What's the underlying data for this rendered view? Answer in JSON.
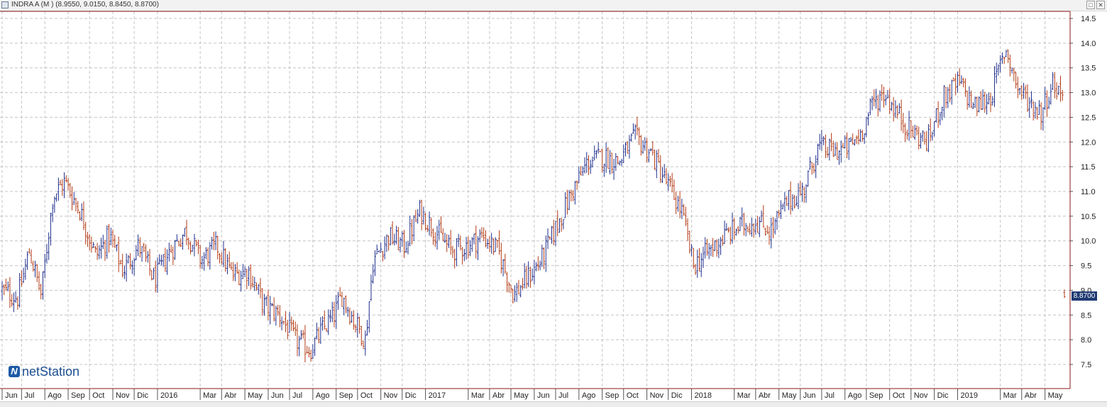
{
  "window": {
    "title": "INDRA A (M ) (8.9550, 9.0150, 8.8450, 8.8700)",
    "buttons": [
      "□",
      "✕"
    ]
  },
  "logo": {
    "mark": "N",
    "text": "netStation"
  },
  "price_tag": "8.8700",
  "colors": {
    "up_bar": "#1f2f8c",
    "down_bar": "#b23a14",
    "grid": "#c4c4c4",
    "frame": "#8b1a1a",
    "price_tag_bg": "#1f3a73"
  },
  "chart_data": {
    "type": "ohlc",
    "title": "INDRA A (M )",
    "last_ohlc": {
      "open": 8.955,
      "high": 9.015,
      "low": 8.845,
      "close": 8.87
    },
    "ylim": [
      7.0,
      14.7
    ],
    "y_ticks": [
      "14.5",
      "14.0",
      "13.5",
      "13.0",
      "12.5",
      "12.0",
      "11.5",
      "11.0",
      "10.5",
      "10.0",
      "9.5",
      "9.0",
      "8.5",
      "8.0",
      "7.5"
    ],
    "x_labels": [
      "Jun",
      "Jul",
      "Ago",
      "Sep",
      "Oct",
      "Nov",
      "Dic",
      "2016",
      "Mar",
      "Abr",
      "May",
      "Jun",
      "Jul",
      "Ago",
      "Sep",
      "Oct",
      "Nov",
      "Dic",
      "2017",
      "Mar",
      "Abr",
      "May",
      "Jun",
      "Jul",
      "Ago",
      "Sep",
      "Oct",
      "Nov",
      "Dic",
      "2018",
      "Mar",
      "Abr",
      "May",
      "Jun",
      "Jul",
      "Ago",
      "Sep",
      "Oct",
      "Nov",
      "Dic",
      "2019",
      "Mar",
      "Abr",
      "May"
    ],
    "x_label_index": [
      0,
      10,
      22,
      34,
      45,
      57,
      68,
      80,
      102,
      113,
      125,
      137,
      148,
      160,
      172,
      183,
      195,
      206,
      218,
      240,
      251,
      262,
      274,
      285,
      297,
      309,
      320,
      332,
      343,
      355,
      377,
      388,
      400,
      411,
      422,
      434,
      445,
      457,
      468,
      480,
      492,
      514,
      525,
      537
    ],
    "num_bars": 548,
    "close_path": [
      [
        0,
        9.0
      ],
      [
        8,
        8.85
      ],
      [
        14,
        9.8
      ],
      [
        20,
        8.9
      ],
      [
        26,
        10.9
      ],
      [
        32,
        11.2
      ],
      [
        40,
        10.6
      ],
      [
        48,
        9.7
      ],
      [
        55,
        10.1
      ],
      [
        62,
        9.4
      ],
      [
        70,
        9.9
      ],
      [
        78,
        9.2
      ],
      [
        86,
        9.8
      ],
      [
        94,
        10.2
      ],
      [
        102,
        9.6
      ],
      [
        110,
        9.9
      ],
      [
        118,
        9.3
      ],
      [
        126,
        9.4
      ],
      [
        134,
        8.7
      ],
      [
        142,
        8.5
      ],
      [
        150,
        8.0
      ],
      [
        158,
        7.8
      ],
      [
        164,
        8.2
      ],
      [
        170,
        8.5
      ],
      [
        174,
        8.9
      ],
      [
        180,
        8.4
      ],
      [
        186,
        8.0
      ],
      [
        190,
        9.6
      ],
      [
        198,
        10.1
      ],
      [
        206,
        9.9
      ],
      [
        214,
        10.6
      ],
      [
        222,
        10.2
      ],
      [
        230,
        9.8
      ],
      [
        238,
        9.9
      ],
      [
        246,
        10.1
      ],
      [
        254,
        9.8
      ],
      [
        262,
        8.9
      ],
      [
        268,
        9.2
      ],
      [
        276,
        9.6
      ],
      [
        284,
        10.3
      ],
      [
        292,
        11.0
      ],
      [
        300,
        11.6
      ],
      [
        308,
        11.7
      ],
      [
        316,
        11.6
      ],
      [
        324,
        12.1
      ],
      [
        332,
        11.8
      ],
      [
        340,
        11.2
      ],
      [
        348,
        10.6
      ],
      [
        354,
        9.5
      ],
      [
        362,
        9.8
      ],
      [
        370,
        10.1
      ],
      [
        378,
        10.3
      ],
      [
        386,
        10.4
      ],
      [
        394,
        10.2
      ],
      [
        402,
        10.8
      ],
      [
        410,
        11.0
      ],
      [
        418,
        11.9
      ],
      [
        426,
        11.8
      ],
      [
        434,
        11.9
      ],
      [
        440,
        12.2
      ],
      [
        446,
        12.8
      ],
      [
        452,
        13.0
      ],
      [
        458,
        12.6
      ],
      [
        466,
        12.2
      ],
      [
        474,
        12.0
      ],
      [
        482,
        12.9
      ],
      [
        490,
        13.2
      ],
      [
        498,
        12.7
      ],
      [
        506,
        12.9
      ],
      [
        514,
        13.9
      ],
      [
        520,
        13.1
      ],
      [
        526,
        12.8
      ],
      [
        532,
        12.6
      ],
      [
        538,
        13.2
      ],
      [
        544,
        12.9
      ]
    ],
    "resampled_note": "",
    "path_scale": 548
  }
}
